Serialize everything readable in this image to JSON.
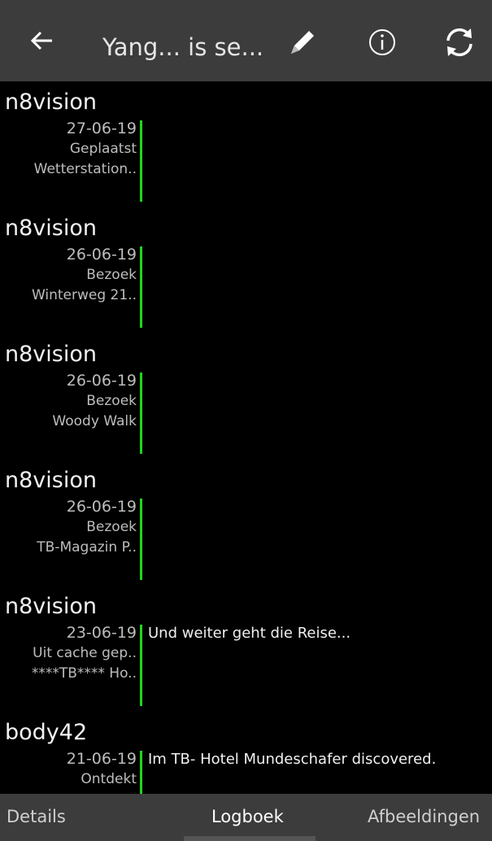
{
  "header": {
    "title": "Yang... is se..."
  },
  "logs": [
    {
      "user": "n8vision",
      "date": "27-06-19",
      "type": "Geplaatst",
      "cache": "Wetterstation..",
      "text": ""
    },
    {
      "user": "n8vision",
      "date": "26-06-19",
      "type": "Bezoek",
      "cache": "Winterweg 21..",
      "text": ""
    },
    {
      "user": "n8vision",
      "date": "26-06-19",
      "type": "Bezoek",
      "cache": "Woody Walk",
      "text": ""
    },
    {
      "user": "n8vision",
      "date": "26-06-19",
      "type": "Bezoek",
      "cache": "TB-Magazin P..",
      "text": ""
    },
    {
      "user": "n8vision",
      "date": "23-06-19",
      "type": "Uit cache gep..",
      "cache": "****TB**** Ho..",
      "text": "Und weiter geht die Reise..."
    },
    {
      "user": "body42",
      "date": "21-06-19",
      "type": "Ontdekt",
      "cache": "",
      "text": "Im TB- Hotel Mundeschafer discovered."
    }
  ],
  "tabs": {
    "details": "Details",
    "logbook": "Logboek",
    "images": "Afbeeldingen"
  },
  "colors": {
    "accent_bar": "#1fd51f",
    "toolbar": "#3c3c3c"
  }
}
